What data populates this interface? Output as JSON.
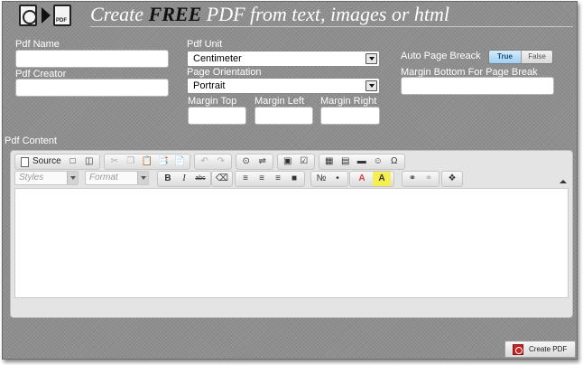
{
  "header": {
    "title_prefix": "Create ",
    "title_emphasis": "FREE",
    "title_suffix": " PDF from text, images or html"
  },
  "form": {
    "pdf_name_label": "Pdf Name",
    "pdf_name_value": "",
    "pdf_creator_label": "Pdf Creator",
    "pdf_creator_value": "",
    "pdf_unit_label": "Pdf Unit",
    "pdf_unit_value": "Centimeter",
    "page_orientation_label": "Page Orientation",
    "page_orientation_value": "Portrait",
    "margin_top_label": "Margin Top",
    "margin_top_value": "",
    "margin_left_label": "Margin Left",
    "margin_left_value": "",
    "margin_right_label": "Margin Right",
    "margin_right_value": "",
    "auto_page_break_label": "Auto Page Breack",
    "auto_page_break_true": "True",
    "auto_page_break_false": "False",
    "auto_page_break_selected": "True",
    "margin_bottom_label": "Margin Bottom For Page Break",
    "margin_bottom_value": ""
  },
  "content": {
    "label": "Pdf Content",
    "source_label": "Source",
    "styles_placeholder": "Styles",
    "format_placeholder": "Format",
    "bold_glyph": "B",
    "italic_glyph": "I",
    "strike_glyph": "abc",
    "omega_glyph": "Ω",
    "font_color_glyph": "A",
    "bg_color_glyph": "A"
  },
  "actions": {
    "create_pdf_label": "Create PDF"
  },
  "colors": {
    "background": "#8f8f8f",
    "title_text": "#ffffff",
    "toggle_active": "#9fcff1",
    "pdf_icon": "#c82424"
  }
}
